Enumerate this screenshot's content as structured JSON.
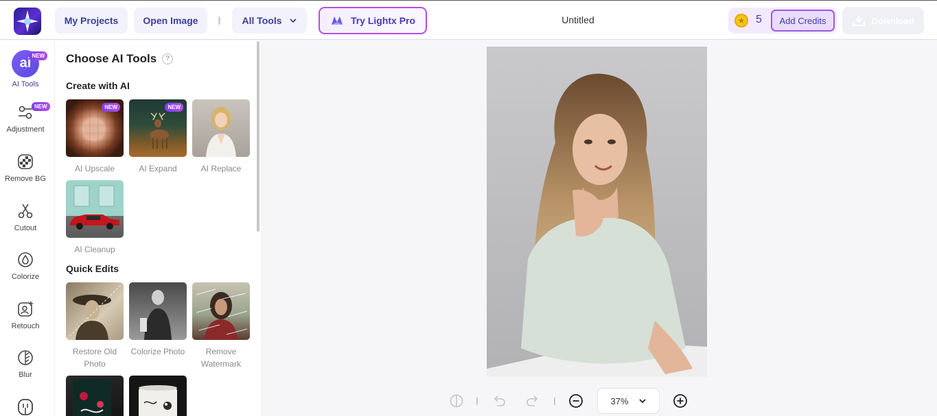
{
  "header": {
    "my_projects": "My Projects",
    "open_image": "Open Image",
    "all_tools": "All Tools",
    "try_pro": "Try Lightx Pro",
    "document_title": "Untitled",
    "credits_count": "5",
    "add_credits": "Add Credits",
    "download": "Download"
  },
  "rail": {
    "ai_glyph": "ai",
    "new_badge": "NEW",
    "items": [
      {
        "label": "AI Tools",
        "icon": "ai-icon"
      },
      {
        "label": "Adjustment",
        "icon": "sliders-icon"
      },
      {
        "label": "Remove BG",
        "icon": "remove-bg-icon"
      },
      {
        "label": "Cutout",
        "icon": "scissors-icon"
      },
      {
        "label": "Colorize",
        "icon": "drop-icon"
      },
      {
        "label": "Retouch",
        "icon": "retouch-icon"
      },
      {
        "label": "Blur",
        "icon": "blur-leaf-icon"
      },
      {
        "label": "",
        "icon": "tool-icon"
      }
    ]
  },
  "panel": {
    "title": "Choose AI Tools",
    "help_glyph": "?",
    "sections": {
      "create": "Create with AI",
      "quick": "Quick Edits"
    },
    "create_tools": [
      {
        "label": "AI Upscale",
        "new": "NEW"
      },
      {
        "label": "AI Expand",
        "new": "NEW"
      },
      {
        "label": "AI Replace"
      },
      {
        "label": "AI Cleanup"
      }
    ],
    "quick_tools": [
      {
        "label": "Restore Old Photo"
      },
      {
        "label": "Colorize Photo"
      },
      {
        "label": "Remove Watermark"
      }
    ]
  },
  "canvas": {
    "zoom": "37%"
  },
  "colors": {
    "accent": "#3d3d9e",
    "pro_border": "#b34ee8",
    "new_badge": "#8b3ff0"
  }
}
